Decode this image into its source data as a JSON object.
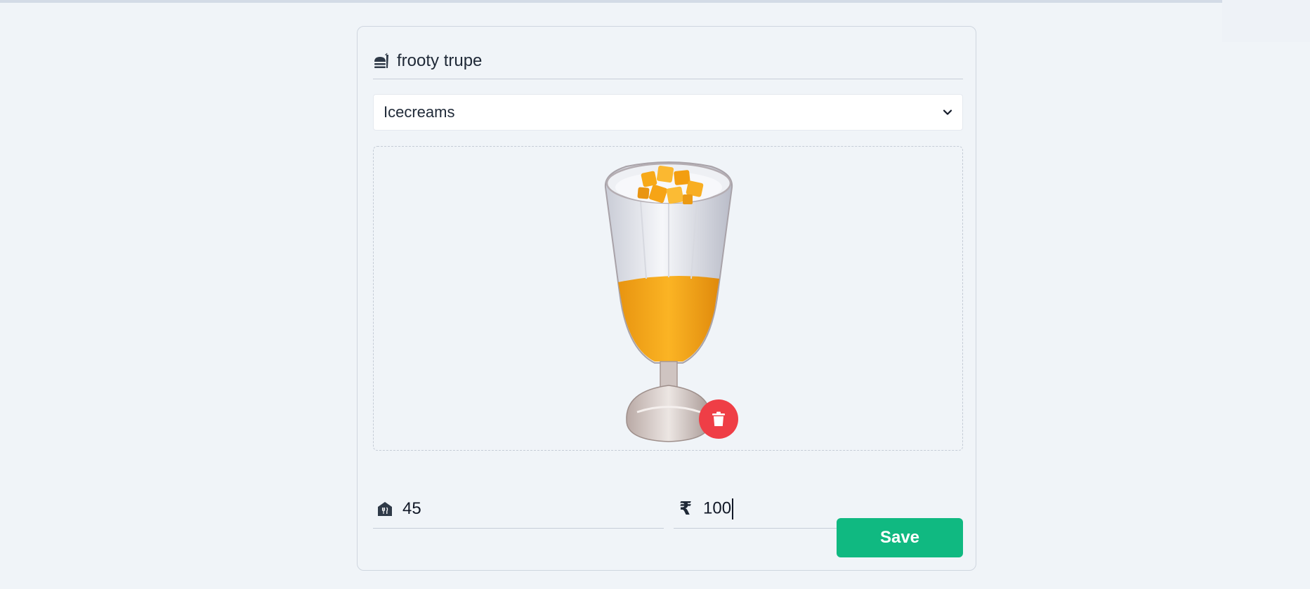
{
  "item": {
    "title": "frooty trupe",
    "title_icon": "food-burger-icon"
  },
  "category_select": {
    "selected": "Icecreams",
    "icon": "chevron-down-icon"
  },
  "image_upload": {
    "image_alt": "mango dessert glass",
    "delete_icon": "trash-icon",
    "delete_color": "#ef3e46"
  },
  "fields": {
    "quantity": {
      "icon": "store-icon",
      "value": "45"
    },
    "price": {
      "icon": "rupee-icon",
      "currency_symbol": "₹",
      "value": "100"
    }
  },
  "actions": {
    "save_label": "Save",
    "save_color": "#10b981"
  }
}
